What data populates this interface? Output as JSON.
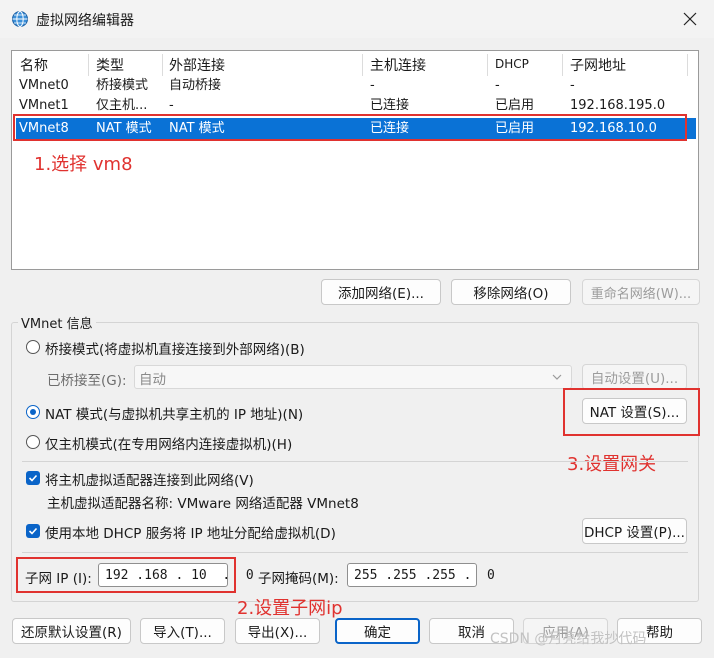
{
  "window": {
    "title": "虚拟网络编辑器"
  },
  "list": {
    "headers": [
      "名称",
      "类型",
      "外部连接",
      "主机连接",
      "DHCP",
      "子网地址"
    ],
    "rows": [
      [
        "VMnet0",
        "桥接模式",
        "自动桥接",
        "-",
        "-",
        "-"
      ],
      [
        "VMnet1",
        "仅主机...",
        "-",
        "已连接",
        "已启用",
        "192.168.195.0"
      ],
      [
        "VMnet8",
        "NAT 模式",
        "NAT 模式",
        "已连接",
        "已启用",
        "192.168.10.0"
      ]
    ],
    "selected_row": 2
  },
  "annotations": {
    "step1": "1.选择 vm8",
    "step2": "2.设置子网ip",
    "step3": "3.设置网关"
  },
  "list_buttons": {
    "add": "添加网络(E)...",
    "remove": "移除网络(O)",
    "rename": "重命名网络(W)..."
  },
  "vmnet_info": {
    "group_title": "VMnet 信息",
    "bridge_mode": "桥接模式(将虚拟机直接连接到外部网络)(B)",
    "bridged_to_label": "已桥接至(G):",
    "bridged_to_value": "自动",
    "auto_settings": "自动设置(U)...",
    "nat_mode": "NAT 模式(与虚拟机共享主机的 IP 地址)(N)",
    "nat_settings": "NAT 设置(S)...",
    "host_only": "仅主机模式(在专用网络内连接虚拟机)(H)",
    "connect_adapter": "将主机虚拟适配器连接到此网络(V)",
    "adapter_name": "主机虚拟适配器名称: VMware 网络适配器 VMnet8",
    "use_dhcp": "使用本地 DHCP 服务将 IP 地址分配给虚拟机(D)",
    "dhcp_settings": "DHCP 设置(P)...",
    "subnet_ip_label": "子网 IP (I):",
    "subnet_ip_value": "192 .168 . 10  .  0",
    "subnet_mask_label": "子网掩码(M):",
    "subnet_mask_value": "255 .255 .255 .  0",
    "selected_mode": "nat"
  },
  "footer": {
    "restore": "还原默认设置(R)",
    "import": "导入(T)...",
    "export": "导出(X)...",
    "ok": "确定",
    "cancel": "取消",
    "apply": "应用(A)",
    "help": "帮助"
  },
  "watermark": "CSDN @月亮给我抄代码",
  "colors": {
    "selection": "#0a72d6",
    "annotation": "#e0322f",
    "accent": "#0a64c8"
  }
}
